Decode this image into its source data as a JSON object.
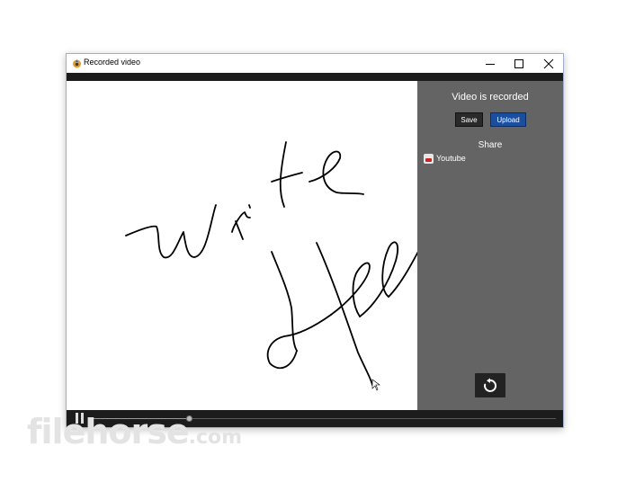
{
  "window": {
    "title": "Recorded video"
  },
  "panel": {
    "title": "Video is recorded",
    "save_label": "Save",
    "upload_label": "Upload",
    "share_label": "Share",
    "share_items": [
      {
        "label": "Youtube",
        "icon": "youtube-icon"
      }
    ],
    "replay_icon": "replay-icon"
  },
  "player": {
    "state": "paused",
    "progress_fraction": 0.21
  },
  "drawing": {
    "stroke_color": "#000000",
    "words": [
      "write",
      "Hello"
    ]
  },
  "watermark": {
    "main": "filehorse",
    "suffix": ".com"
  },
  "colors": {
    "panel_bg": "#646464",
    "upload_button": "#1a4e9e",
    "bars": "#1c1c1c"
  }
}
